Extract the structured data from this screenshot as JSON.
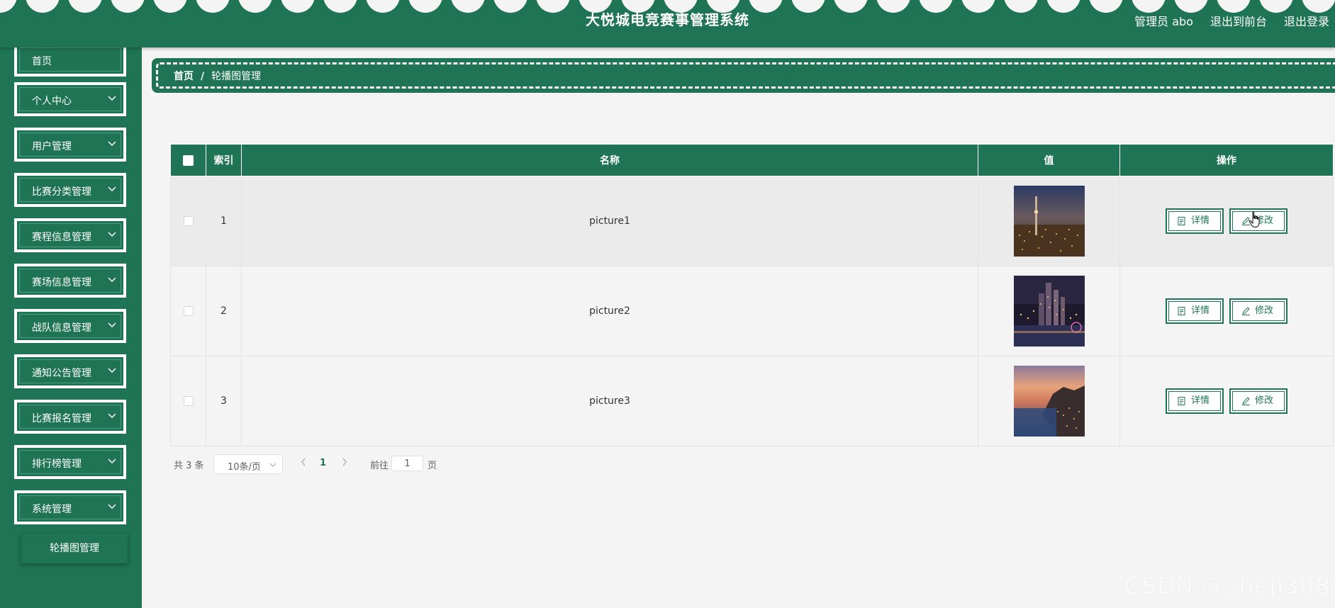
{
  "header": {
    "title": "大悦城电竞赛事管理系统",
    "admin_label": "管理员 abo",
    "to_front_label": "退出到前台",
    "logout_label": "退出登录"
  },
  "sidebar": {
    "items": [
      {
        "label": "首页"
      },
      {
        "label": "个人中心"
      },
      {
        "label": "用户管理"
      },
      {
        "label": "比赛分类管理"
      },
      {
        "label": "赛程信息管理"
      },
      {
        "label": "赛场信息管理"
      },
      {
        "label": "战队信息管理"
      },
      {
        "label": "通知公告管理"
      },
      {
        "label": "比赛报名管理"
      },
      {
        "label": "排行榜管理"
      },
      {
        "label": "系统管理"
      }
    ],
    "submenu_label": "轮播图管理"
  },
  "breadcrumb": {
    "home": "首页",
    "separator": "/",
    "current": "轮播图管理"
  },
  "table": {
    "columns": [
      "索引",
      "名称",
      "值",
      "操作"
    ],
    "rows": [
      {
        "index": "1",
        "name": "picture1",
        "value": "city-night-tower-photo"
      },
      {
        "index": "2",
        "name": "picture2",
        "value": "city-harbor-night-photo"
      },
      {
        "index": "3",
        "name": "picture3",
        "value": "coastal-cliff-sunset-photo"
      }
    ],
    "detail_label": "详情",
    "edit_label": "修改"
  },
  "pagination": {
    "total": "共 3 条",
    "page_size": "10条/页",
    "current_page": "1",
    "goto_label": "前往",
    "goto_value": "1",
    "page_suffix": "页"
  },
  "watermark": "CSDN @sheji308",
  "colors": {
    "primary": "#1f7455",
    "background": "#f4f4f4",
    "white": "#ffffff"
  }
}
